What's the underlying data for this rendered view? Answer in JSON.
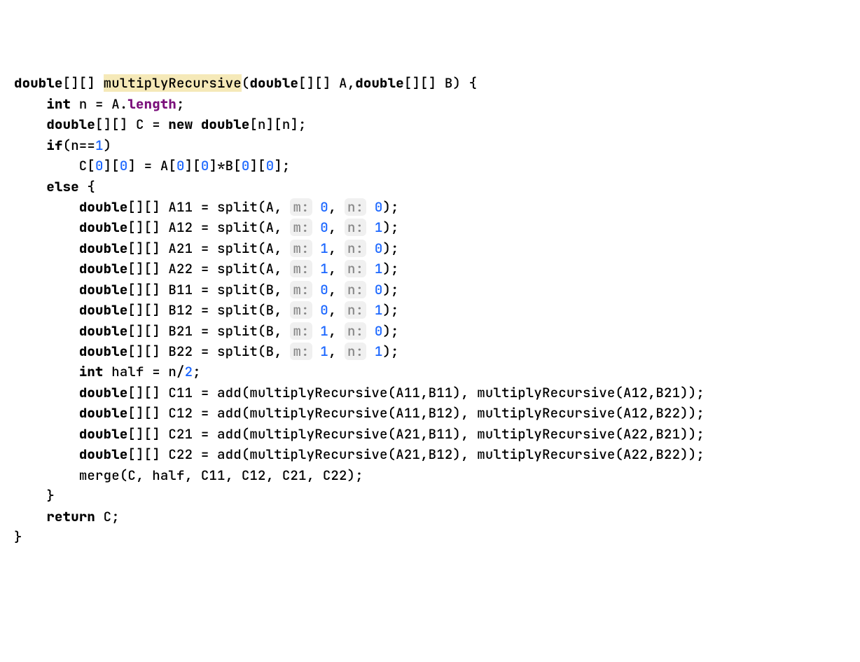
{
  "code": {
    "line1": {
      "kw1": "double",
      "brackets1": "[][] ",
      "method": "multiplyRecursive",
      "paren_open": "(",
      "kw2": "double",
      "param_a": "[][] A,",
      "kw3": "double",
      "param_b": "[][] B) {",
      "empty": ""
    },
    "line2": {
      "empty": ""
    },
    "line3": {
      "indent": "    ",
      "kw": "int",
      "rest": " n = A.",
      "field": "length",
      "semi": ";"
    },
    "line4": {
      "indent": "    ",
      "kw1": "double",
      "text1": "[][] C = ",
      "kw2": "new double",
      "text2": "[n][n];"
    },
    "line5": {
      "indent": "    ",
      "kw": "if",
      "text1": "(n==",
      "num": "1",
      "text2": ")"
    },
    "line6": {
      "indent": "        C[",
      "n0a": "0",
      "t1": "][",
      "n0b": "0",
      "t2": "] = A[",
      "n0c": "0",
      "t3": "][",
      "n0d": "0",
      "t4": "]*B[",
      "n0e": "0",
      "t5": "][",
      "n0f": "0",
      "t6": "];"
    },
    "line7": {
      "indent": "    ",
      "kw": "else",
      "text": " {"
    },
    "line8": {
      "empty": ""
    },
    "split": {
      "a11": {
        "kw": "double",
        "text": "[][] A11 = split(A, ",
        "h1": "m:",
        "v1": " 0",
        "c": ", ",
        "h2": "n:",
        "v2": " 0",
        "end": ");"
      },
      "a12": {
        "kw": "double",
        "text": "[][] A12 = split(A, ",
        "h1": "m:",
        "v1": " 0",
        "c": ", ",
        "h2": "n:",
        "v2": " 1",
        "end": ");"
      },
      "a21": {
        "kw": "double",
        "text": "[][] A21 = split(A, ",
        "h1": "m:",
        "v1": " 1",
        "c": ", ",
        "h2": "n:",
        "v2": " 0",
        "end": ");"
      },
      "a22": {
        "kw": "double",
        "text": "[][] A22 = split(A, ",
        "h1": "m:",
        "v1": " 1",
        "c": ", ",
        "h2": "n:",
        "v2": " 1",
        "end": ");"
      },
      "b11": {
        "kw": "double",
        "text": "[][] B11 = split(B, ",
        "h1": "m:",
        "v1": " 0",
        "c": ", ",
        "h2": "n:",
        "v2": " 0",
        "end": ");"
      },
      "b12": {
        "kw": "double",
        "text": "[][] B12 = split(B, ",
        "h1": "m:",
        "v1": " 0",
        "c": ", ",
        "h2": "n:",
        "v2": " 1",
        "end": ");"
      },
      "b21": {
        "kw": "double",
        "text": "[][] B21 = split(B, ",
        "h1": "m:",
        "v1": " 1",
        "c": ", ",
        "h2": "n:",
        "v2": " 0",
        "end": ");"
      },
      "b22": {
        "kw": "double",
        "text": "[][] B22 = split(B, ",
        "h1": "m:",
        "v1": " 1",
        "c": ", ",
        "h2": "n:",
        "v2": " 1",
        "end": ");"
      }
    },
    "half": {
      "indent": "        ",
      "kw": "int",
      "text1": " half = n/",
      "num": "2",
      "text2": ";"
    },
    "cblock": {
      "c11": {
        "kw": "double",
        "text": "[][] C11 = add(multiplyRecursive(A11,B11), multiplyRecursive(A12,B21));"
      },
      "c12": {
        "kw": "double",
        "text": "[][] C12 = add(multiplyRecursive(A11,B12), multiplyRecursive(A12,B22));"
      },
      "c21": {
        "kw": "double",
        "text": "[][] C21 = add(multiplyRecursive(A21,B11), multiplyRecursive(A22,B21));"
      },
      "c22": {
        "kw": "double",
        "text": "[][] C22 = add(multiplyRecursive(A21,B12), multiplyRecursive(A22,B22));"
      }
    },
    "merge": {
      "indent": "        ",
      "text": "merge(C, half, C11, C12, C21, C22);"
    },
    "close_else": {
      "indent": "    ",
      "text": "}"
    },
    "return": {
      "indent": "    ",
      "kw": "return",
      "text": " C;"
    },
    "close_method": {
      "text": "}"
    },
    "indent2": "        "
  }
}
